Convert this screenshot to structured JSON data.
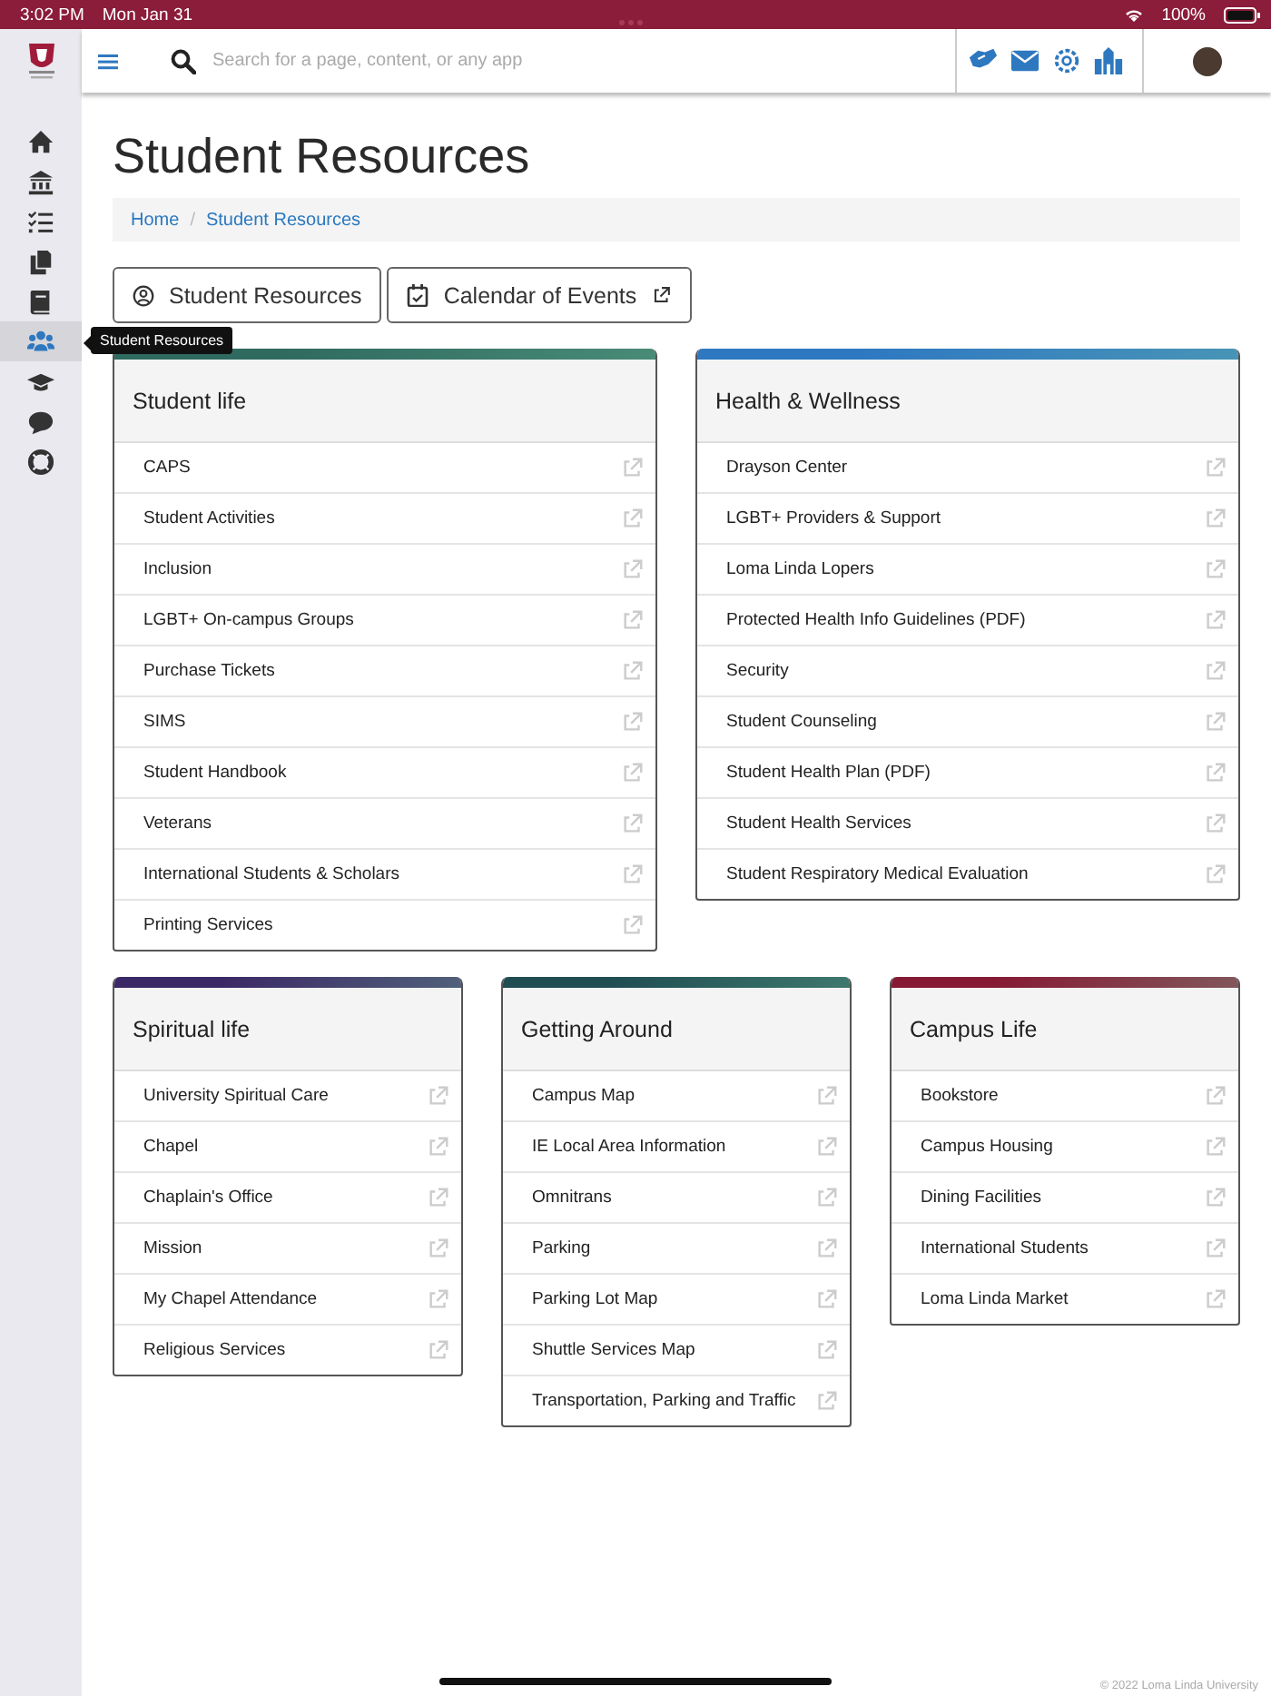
{
  "status_bar": {
    "time": "3:02 PM",
    "date": "Mon Jan 31",
    "battery": "100%"
  },
  "top_bar": {
    "search": {
      "placeholder": "Search for a page, content, or any app"
    }
  },
  "sidebar": {
    "items": [
      {
        "selected": false
      },
      {
        "selected": false
      },
      {
        "selected": false
      },
      {
        "selected": false
      },
      {
        "selected": false
      },
      {
        "selected": true
      },
      {
        "selected": false
      },
      {
        "selected": false
      },
      {
        "selected": false
      }
    ],
    "tooltip": "Student Resources"
  },
  "page": {
    "title": "Student Resources",
    "breadcrumb": [
      {
        "label": "Home"
      },
      {
        "label": "Student Resources"
      }
    ],
    "breadcrumb_separator": "/",
    "buttons": [
      {
        "label": "Student Resources",
        "kind": "person"
      },
      {
        "label": "Calendar of Events",
        "kind": "calendar"
      }
    ]
  },
  "cards": [
    {
      "title": "Student life",
      "color": "#2f6a60",
      "links": [
        "CAPS",
        "Student Activities",
        "Inclusion",
        "LGBT+ On-campus Groups",
        "Purchase Tickets",
        "SIMS",
        "Student Handbook",
        "Veterans",
        "International Students & Scholars",
        "Printing Services"
      ]
    },
    {
      "title": "Health & Wellness",
      "color": "#2e78c2",
      "links": [
        "Drayson Center",
        "LGBT+ Providers & Support",
        "Loma Linda Lopers",
        "Protected Health Info Guidelines (PDF)",
        "Security",
        "Student Counseling",
        "Student Health Plan (PDF)",
        "Student Health Services",
        "Student Respiratory Medical Evaluation"
      ]
    },
    {
      "title": "Spiritual life",
      "color": "#3b2866",
      "links": [
        "University Spiritual Care",
        "Chapel",
        "Chaplain's Office",
        "Mission",
        "My Chapel Attendance",
        "Religious Services"
      ]
    },
    {
      "title": "Getting Around",
      "color": "#1f4d52",
      "links": [
        "Campus Map",
        "IE Local Area Information",
        "Omnitrans",
        "Parking",
        "Parking Lot Map",
        "Shuttle Services Map",
        "Transportation, Parking and Traffic"
      ]
    },
    {
      "title": "Campus Life",
      "color": "#861a35",
      "links": [
        "Bookstore",
        "Campus Housing",
        "Dining Facilities",
        "International Students",
        "Loma Linda Market"
      ]
    }
  ],
  "footer": "© 2022 Loma Linda University"
}
